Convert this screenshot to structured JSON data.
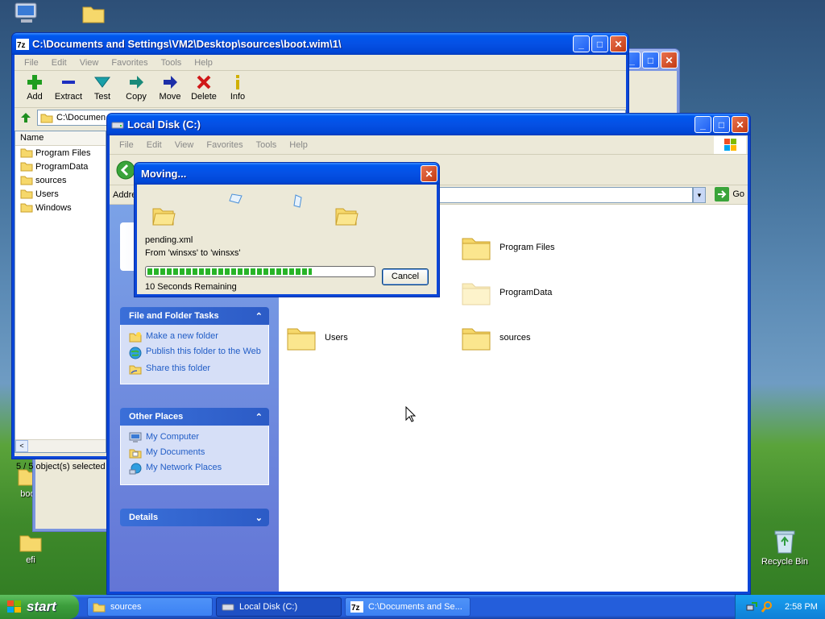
{
  "desktop": {
    "icons": [
      {
        "label": "boot"
      },
      {
        "label": "efi"
      },
      {
        "label": "Recycle Bin"
      }
    ]
  },
  "zip_window": {
    "title": "C:\\Documents and Settings\\VM2\\Desktop\\sources\\boot.wim\\1\\",
    "menu": [
      "File",
      "Edit",
      "View",
      "Favorites",
      "Tools",
      "Help"
    ],
    "toolbar": [
      {
        "label": "Add",
        "icon": "add-icon",
        "color": "#1f9d1f"
      },
      {
        "label": "Extract",
        "icon": "extract-icon",
        "color": "#1d2fc0"
      },
      {
        "label": "Test",
        "icon": "test-icon",
        "color": "#1aa0a8"
      },
      {
        "label": "Copy",
        "icon": "copy-icon",
        "color": "#1a8a7a"
      },
      {
        "label": "Move",
        "icon": "move-icon",
        "color": "#1d2fa8"
      },
      {
        "label": "Delete",
        "icon": "delete-icon",
        "color": "#d01818"
      },
      {
        "label": "Info",
        "icon": "info-icon",
        "color": "#d0b000"
      }
    ],
    "address": "C:\\Documen",
    "column_name": "Name",
    "files": [
      "Program Files",
      "ProgramData",
      "sources",
      "Users",
      "Windows"
    ],
    "status": "5 / 5 object(s) selected"
  },
  "explorer_window": {
    "title": "Local Disk (C:)",
    "menu": [
      "File",
      "Edit",
      "View",
      "Favorites",
      "Tools",
      "Help"
    ],
    "address_label": "Addre",
    "go_label": "Go",
    "file_tasks": {
      "header": "File and Folder Tasks",
      "links": [
        "Make a new folder",
        "Publish this folder to the Web",
        "Share this folder"
      ]
    },
    "other_places": {
      "header": "Other Places",
      "links": [
        "My Computer",
        "My Documents",
        "My Network Places"
      ]
    },
    "details": {
      "header": "Details"
    },
    "folders": [
      "Program Files",
      "ProgramData",
      "Users",
      "sources"
    ]
  },
  "moving_dialog": {
    "title": "Moving...",
    "filename": "pending.xml",
    "from_to": "From 'winsxs' to 'winsxs'",
    "progress": 0.73,
    "remaining": "10 Seconds Remaining",
    "cancel_label": "Cancel"
  },
  "taskbar": {
    "start_label": "start",
    "items": [
      {
        "label": "sources"
      },
      {
        "label": "Local Disk (C:)"
      },
      {
        "label": "C:\\Documents and Se..."
      }
    ],
    "clock": "2:58 PM"
  }
}
